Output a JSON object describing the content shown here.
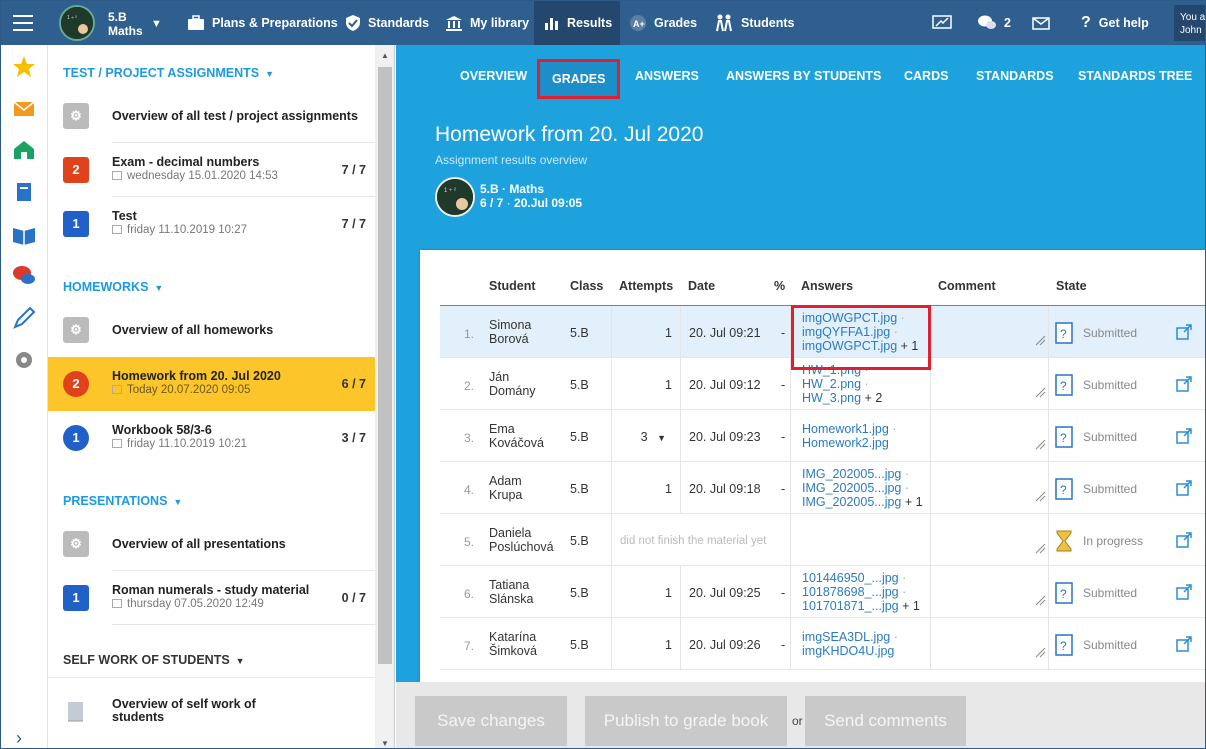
{
  "topbar": {
    "class_line1": "5.B",
    "class_line2": "Maths",
    "nav": [
      "Plans & Preparations",
      "Standards",
      "My library",
      "Results",
      "Grades",
      "Students"
    ],
    "message_count": "2",
    "help": "Get help",
    "user_line1": "You a",
    "user_line2": "John"
  },
  "left": {
    "sec_tests": "TEST / PROJECT ASSIGNMENTS",
    "tests": [
      {
        "title": "Overview of all test / project assignments"
      },
      {
        "badge": "2",
        "title": "Exam - decimal numbers",
        "date": "wednesday 15.01.2020 14:53",
        "count": "7 / 7"
      },
      {
        "badge": "1",
        "title": "Test",
        "date": "friday 11.10.2019 10:27",
        "count": "7 / 7"
      }
    ],
    "sec_homeworks": "HOMEWORKS",
    "homeworks": [
      {
        "title": "Overview of all homeworks"
      },
      {
        "badge": "2",
        "title": "Homework from 20. Jul 2020",
        "date": "Today 20.07.2020 09:05",
        "count": "6 / 7"
      },
      {
        "badge": "1",
        "title": "Workbook 58/3-6",
        "date": "friday 11.10.2019 10:21",
        "count": "3 / 7"
      }
    ],
    "sec_presentations": "PRESENTATIONS",
    "presentations": [
      {
        "title": "Overview of all presentations"
      },
      {
        "badge": "1",
        "title": "Roman numerals - study material",
        "date": "thursday 07.05.2020 12:49",
        "count": "0 / 7"
      }
    ],
    "sec_self": "SELF WORK OF STUDENTS",
    "self": [
      {
        "title": "Overview of self work of",
        "title2": "students"
      }
    ]
  },
  "tabs": [
    "OVERVIEW",
    "GRADES",
    "ANSWERS",
    "ANSWERS BY STUDENTS",
    "CARDS",
    "STANDARDS",
    "STANDARDS TREE"
  ],
  "hero": {
    "title": "Homework from 20. Jul 2020",
    "subtitle": "Assignment results overview",
    "class": "5.B · Maths",
    "count": "6 / 7",
    "sep": " · ",
    "date": "20.Jul 09:05"
  },
  "table": {
    "headers": [
      "Student",
      "Class",
      "Attempts",
      "Date",
      "%",
      "Answers",
      "Comment",
      "State"
    ],
    "rows": [
      {
        "num": "1.",
        "first": "Simona",
        "last": "Borová",
        "class": "5.B",
        "attempts": "1",
        "date": "20. Jul 09:21",
        "pct": "-",
        "files": [
          "imgOWGPCT.jpg",
          "imgQYFFA1.jpg",
          "imgOWGPCT.jpg"
        ],
        "more": "+ 1",
        "state": "Submitted"
      },
      {
        "num": "2.",
        "first": "Ján",
        "last": "Domány",
        "class": "5.B",
        "attempts": "1",
        "date": "20. Jul 09:12",
        "pct": "-",
        "files": [
          "HW_1.png",
          "HW_2.png",
          "HW_3.png"
        ],
        "more": "+ 2",
        "state": "Submitted"
      },
      {
        "num": "3.",
        "first": "Ema",
        "last": "Kováčová",
        "class": "5.B",
        "attempts": "3",
        "date": "20. Jul 09:23",
        "pct": "-",
        "files": [
          "Homework1.jpg",
          "Homework2.jpg"
        ],
        "more": "",
        "state": "Submitted"
      },
      {
        "num": "4.",
        "first": "Adam",
        "last": "Krupa",
        "class": "5.B",
        "attempts": "1",
        "date": "20. Jul 09:18",
        "pct": "-",
        "files": [
          "IMG_202005...jpg",
          "IMG_202005...jpg",
          "IMG_202005...jpg"
        ],
        "more": "+ 1",
        "state": "Submitted"
      },
      {
        "num": "5.",
        "first": "Daniela",
        "last": "Poslúchová",
        "class": "5.B",
        "dnf": "did not finish the material yet",
        "state": "In progress"
      },
      {
        "num": "6.",
        "first": "Tatiana",
        "last": "Slánska",
        "class": "5.B",
        "attempts": "1",
        "date": "20. Jul 09:25",
        "pct": "-",
        "files": [
          "101446950_...jpg",
          "101878698_...jpg",
          "101701871_...jpg"
        ],
        "more": "+ 1",
        "state": "Submitted"
      },
      {
        "num": "7.",
        "first": "Katarína",
        "last": "Šimková",
        "class": "5.B",
        "attempts": "1",
        "date": "20. Jul 09:26",
        "pct": "-",
        "files": [
          "imgSEA3DL.jpg",
          "imgKHDO4U.jpg"
        ],
        "more": "",
        "state": "Submitted"
      }
    ]
  },
  "footer": {
    "save": "Save changes",
    "publish": "Publish to grade book",
    "or": "or",
    "send": "Send comments"
  },
  "colors": {
    "topbar": "#2f5f8f",
    "accent": "#1da2de",
    "selected": "#fcc52a",
    "highlight_box": "#e02030"
  }
}
